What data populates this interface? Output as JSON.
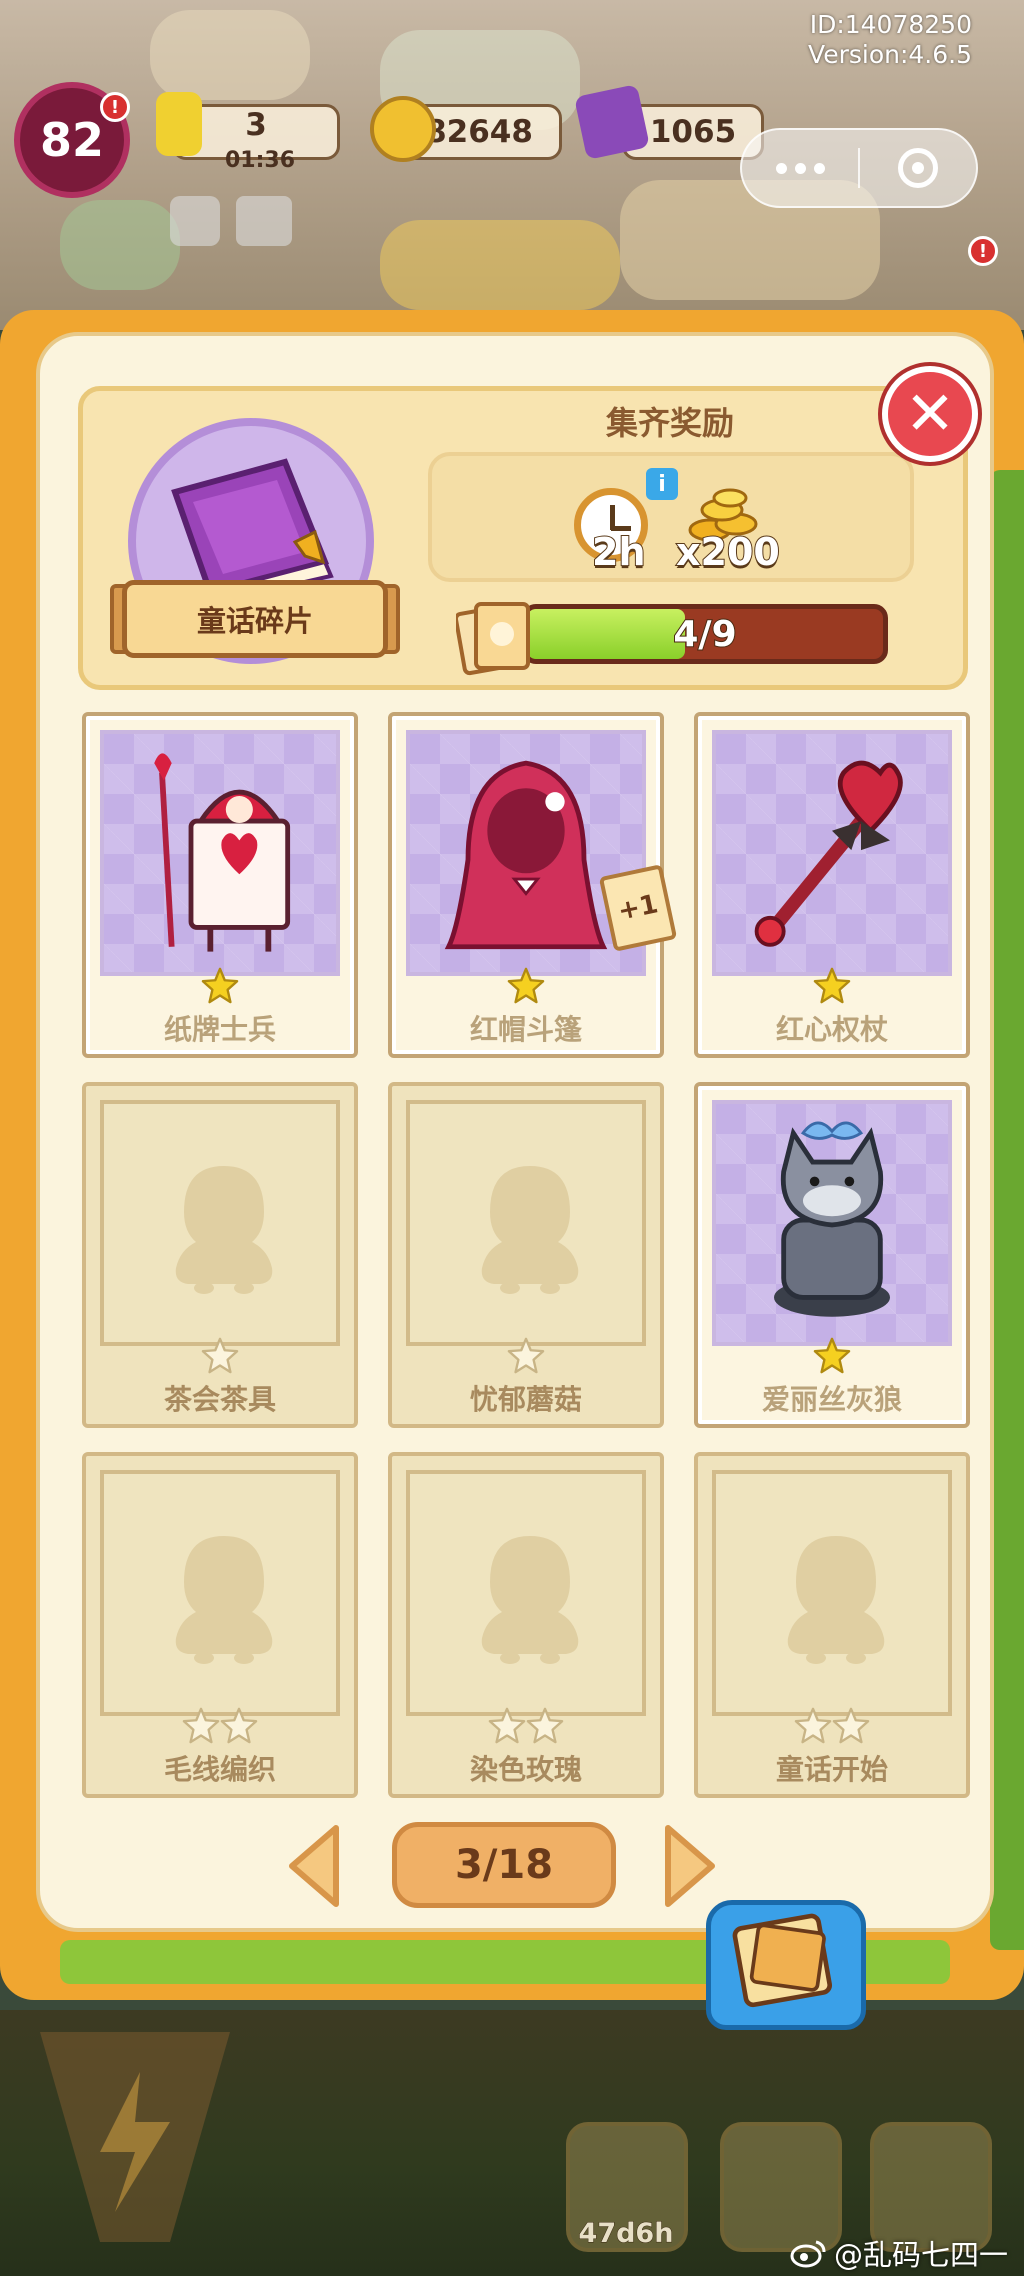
{
  "status": {
    "id_text": "ID:14078250",
    "version_text": "Version:4.6.5"
  },
  "hud": {
    "level": "82",
    "energy_value": "3",
    "energy_timer": "01:36",
    "coins_value": "82648",
    "gems_value": "1065"
  },
  "popup": {
    "book_label": "童话碎片",
    "reward_title": "集齐奖励",
    "reward_time": "2h",
    "reward_coins": "x200",
    "progress_text": "4/9",
    "progress_fraction": 0.444,
    "close_symbol": "✕",
    "plus_badge": "+1",
    "cards": [
      {
        "name": "纸牌士兵",
        "stars": 1,
        "collected": true
      },
      {
        "name": "红帽斗篷",
        "stars": 1,
        "collected": true
      },
      {
        "name": "红心权杖",
        "stars": 1,
        "collected": true
      },
      {
        "name": "茶会茶具",
        "stars": 1,
        "collected": false
      },
      {
        "name": "忧郁蘑菇",
        "stars": 1,
        "collected": false
      },
      {
        "name": "爱丽丝灰狼",
        "stars": 1,
        "collected": true
      },
      {
        "name": "毛线编织",
        "stars": 2,
        "collected": false
      },
      {
        "name": "染色玫瑰",
        "stars": 2,
        "collected": false
      },
      {
        "name": "童话开始",
        "stars": 2,
        "collected": false
      }
    ],
    "page_text": "3/18"
  },
  "bottom": {
    "timer_text": "47d6h",
    "watermark": "@乱码七四一"
  },
  "icons": {
    "close": "close-icon",
    "clock": "clock-icon",
    "info": "info-icon",
    "coins": "coins-icon",
    "prev": "arrow-left-icon",
    "next": "arrow-right-icon"
  },
  "colors": {
    "frame_orange": "#f0a630",
    "inner_cream": "#fbf4dd",
    "progress_green": "#8ad02a",
    "progress_track": "#9a3a22",
    "close_red": "#e84850",
    "card_purple": "#c4b0e6",
    "star_yellow": "#f5d020"
  }
}
